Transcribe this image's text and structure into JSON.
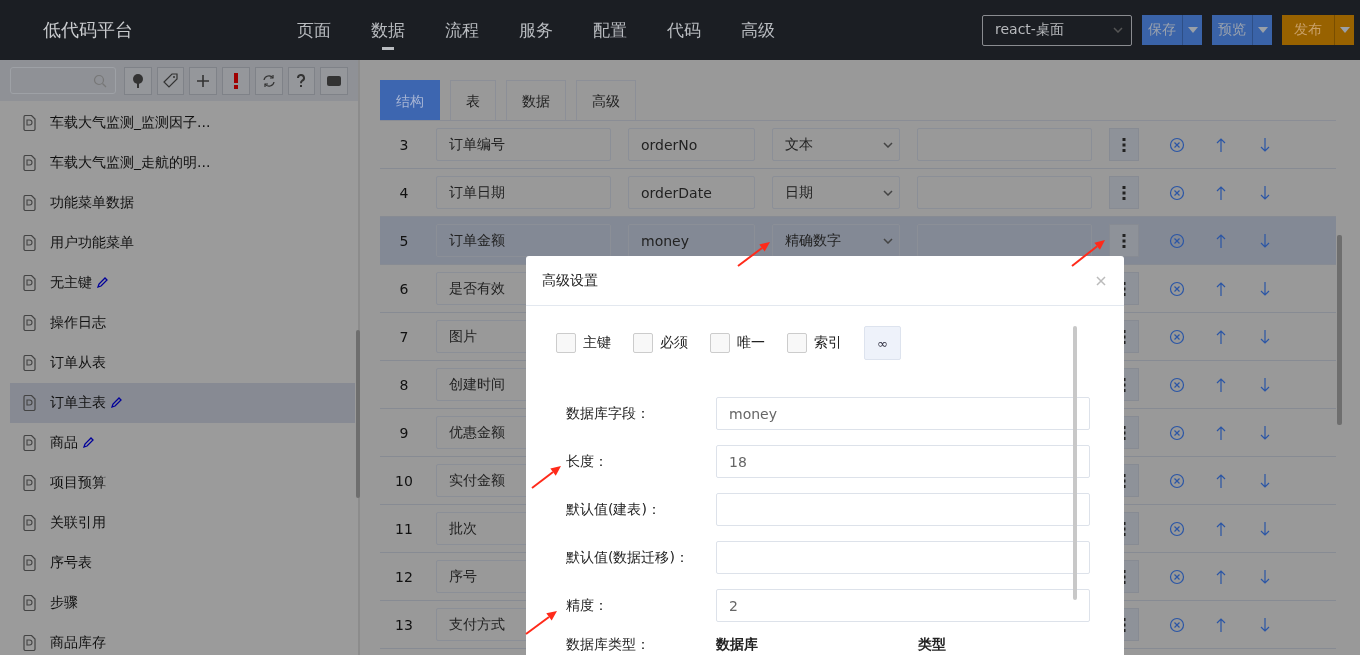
{
  "app": {
    "title": "低代码平台"
  },
  "nav": [
    {
      "label": "页面",
      "selected": false
    },
    {
      "label": "数据",
      "selected": true
    },
    {
      "label": "流程",
      "selected": false
    },
    {
      "label": "服务",
      "selected": false
    },
    {
      "label": "配置",
      "selected": false
    },
    {
      "label": "代码",
      "selected": false
    },
    {
      "label": "高级",
      "selected": false
    }
  ],
  "env_select": {
    "value": "react-桌面"
  },
  "actions": [
    {
      "label": "保存",
      "kind": "primary"
    },
    {
      "label": "预览",
      "kind": "primary"
    },
    {
      "label": "发布",
      "kind": "warning"
    }
  ],
  "sidebar": {
    "items": [
      {
        "label": "车载大气监测_监测因子...",
        "editable": false,
        "selected": false
      },
      {
        "label": "车载大气监测_走航的明...",
        "editable": false,
        "selected": false
      },
      {
        "label": "功能菜单数据",
        "editable": false,
        "selected": false
      },
      {
        "label": "用户功能菜单",
        "editable": false,
        "selected": false
      },
      {
        "label": "无主键",
        "editable": true,
        "selected": false
      },
      {
        "label": "操作日志",
        "editable": false,
        "selected": false
      },
      {
        "label": "订单从表",
        "editable": false,
        "selected": false
      },
      {
        "label": "订单主表",
        "editable": true,
        "selected": true
      },
      {
        "label": "商品",
        "editable": true,
        "selected": false
      },
      {
        "label": "项目预算",
        "editable": false,
        "selected": false
      },
      {
        "label": "关联引用",
        "editable": false,
        "selected": false
      },
      {
        "label": "序号表",
        "editable": false,
        "selected": false
      },
      {
        "label": "步骤",
        "editable": false,
        "selected": false
      },
      {
        "label": "商品库存",
        "editable": false,
        "selected": false
      }
    ]
  },
  "tabs": [
    {
      "label": "结构",
      "selected": true
    },
    {
      "label": "表",
      "selected": false
    },
    {
      "label": "数据",
      "selected": false
    },
    {
      "label": "高级",
      "selected": false
    }
  ],
  "fields": [
    {
      "index": "3",
      "name": "订单编号",
      "code": "orderNo",
      "type": "文本",
      "selected": false
    },
    {
      "index": "4",
      "name": "订单日期",
      "code": "orderDate",
      "type": "日期",
      "selected": false
    },
    {
      "index": "5",
      "name": "订单金额",
      "code": "money",
      "type": "精确数字",
      "selected": true
    },
    {
      "index": "6",
      "name": "是否有效",
      "selected": false
    },
    {
      "index": "7",
      "name": "图片",
      "selected": false
    },
    {
      "index": "8",
      "name": "创建时间",
      "selected": false
    },
    {
      "index": "9",
      "name": "优惠金额",
      "selected": false
    },
    {
      "index": "10",
      "name": "实付金额",
      "selected": false
    },
    {
      "index": "11",
      "name": "批次",
      "selected": false
    },
    {
      "index": "12",
      "name": "序号",
      "selected": false
    },
    {
      "index": "13",
      "name": "支付方式",
      "selected": false
    }
  ],
  "dialog": {
    "title": "高级设置",
    "flags": [
      {
        "label": "主键",
        "checked": false
      },
      {
        "label": "必须",
        "checked": false
      },
      {
        "label": "唯一",
        "checked": false
      },
      {
        "label": "索引",
        "checked": false
      }
    ],
    "link_button": {
      "label": "∞"
    },
    "form": [
      {
        "label": "数据库字段：",
        "value": "money"
      },
      {
        "label": "长度：",
        "value": "18"
      },
      {
        "label": "默认值(建表)："
      },
      {
        "label": "默认值(数据迁移)："
      },
      {
        "label": "精度：",
        "value": "2"
      }
    ],
    "db_type": {
      "label": "数据库类型：",
      "columns": [
        "数据库",
        "类型"
      ]
    }
  }
}
